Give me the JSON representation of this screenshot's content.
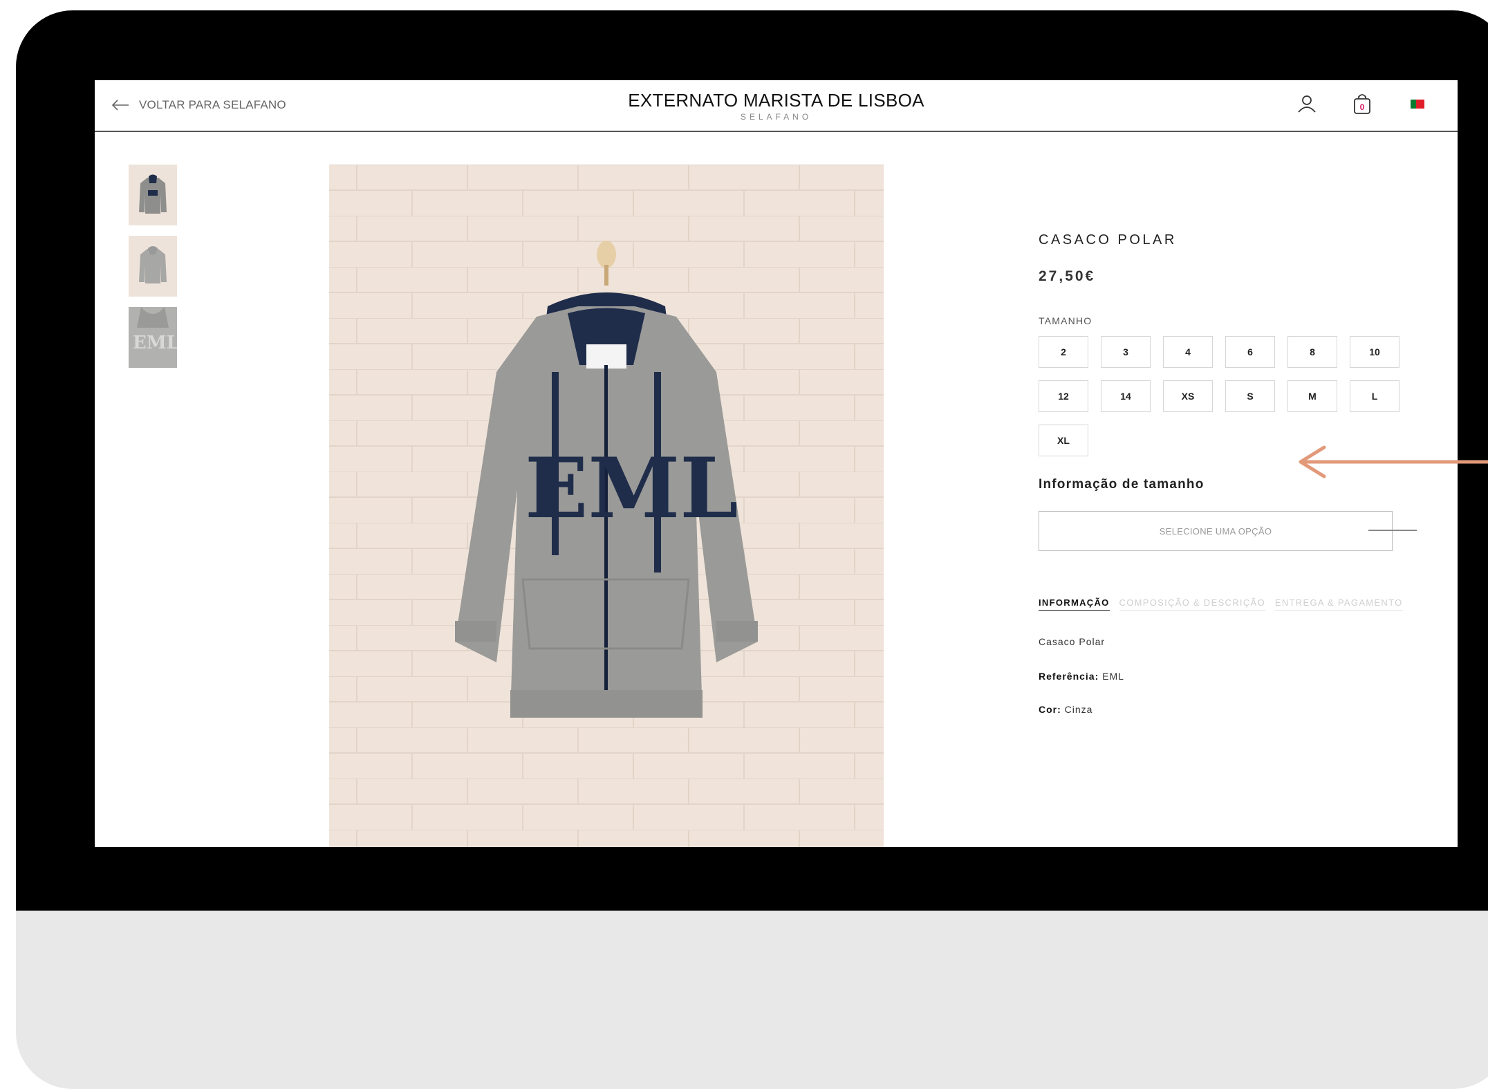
{
  "header": {
    "back_label": "VOLTAR PARA SELAFANO",
    "store_title": "EXTERNATO MARISTA DE LISBOA",
    "store_subtitle": "SELAFANO",
    "cart_count": "0"
  },
  "product": {
    "title": "CASACO POLAR",
    "price": "27,50€",
    "size_label": "TAMANHO",
    "sizes": [
      "2",
      "3",
      "4",
      "6",
      "8",
      "10",
      "12",
      "14",
      "XS",
      "S",
      "M",
      "L",
      "XL"
    ],
    "size_info_label": "Informação de tamanho",
    "select_placeholder": "SELECIONE UMA OPÇÃO",
    "image_text": "EML"
  },
  "tabs": [
    {
      "label": "INFORMAÇÃO",
      "active": true
    },
    {
      "label": "COMPOSIÇÃO & DESCRIÇÃO",
      "active": false
    },
    {
      "label": "ENTREGA & PAGAMENTO",
      "active": false
    }
  ],
  "info": {
    "description": "Casaco Polar",
    "reference_label": "Referência:",
    "reference_value": "EML",
    "color_label": "Cor:",
    "color_value": "Cinza"
  },
  "colors": {
    "annotation_arrow": "#e2997a",
    "jacket": "#9a9a98",
    "print": "#1f2d4a",
    "wall": "#f0e4da"
  }
}
